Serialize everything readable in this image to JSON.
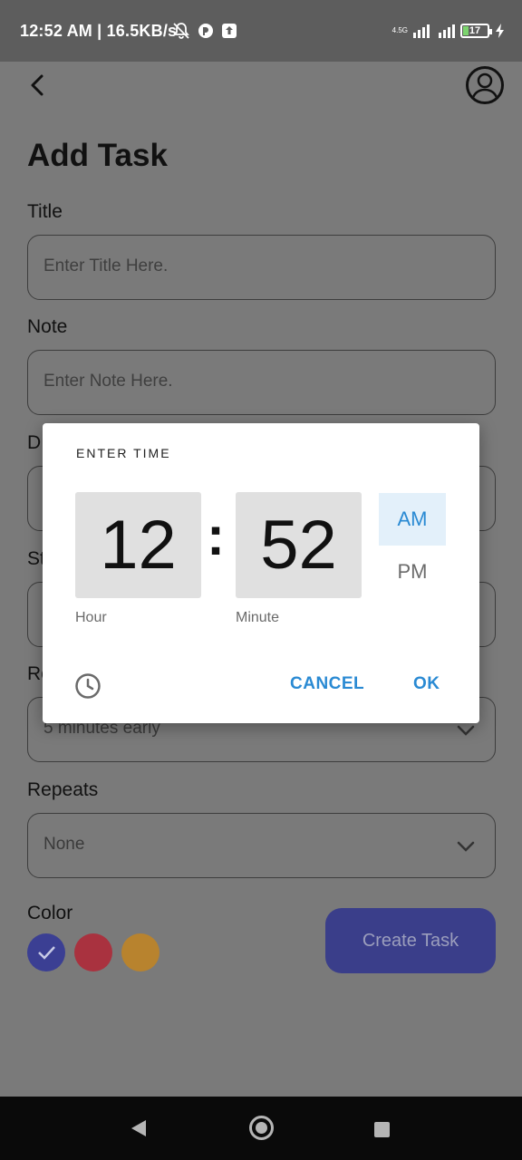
{
  "status_bar": {
    "text": "12:52 AM | 16.5KB/s",
    "network_label": "4.5G",
    "battery": "17"
  },
  "app": {
    "title": "Add Task",
    "fields": {
      "title_label": "Title",
      "title_placeholder": "Enter Title Here.",
      "note_label": "Note",
      "note_placeholder": "Enter Note Here.",
      "date_label_partial": "D",
      "start_label_partial": "St",
      "remind_label_partial": "Re",
      "remind_value": "5 minutes early",
      "repeat_label": "Repeats",
      "repeat_value": "None",
      "color_label": "Color"
    },
    "colors": [
      "#3b3f93",
      "#a9323f",
      "#b8832e"
    ],
    "selected_color_index": 0,
    "create_button": "Create Task"
  },
  "time_dialog": {
    "title": "ENTER TIME",
    "hour": "12",
    "minute": "52",
    "separator": ":",
    "hour_caption": "Hour",
    "minute_caption": "Minute",
    "am_label": "AM",
    "pm_label": "PM",
    "selected_period": "AM",
    "cancel_label": "CANCEL",
    "ok_label": "OK",
    "mode_icon": "clock-icon"
  }
}
